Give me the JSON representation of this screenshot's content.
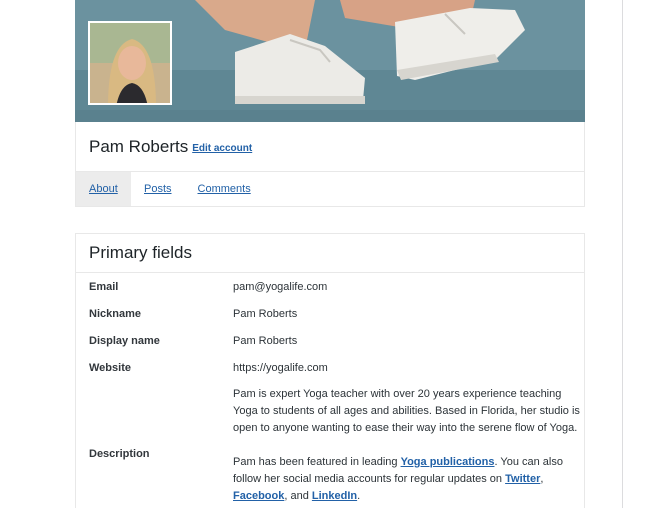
{
  "profile": {
    "name": "Pam Roberts",
    "edit_label": "Edit account"
  },
  "tabs": [
    {
      "label": "About",
      "active": true
    },
    {
      "label": "Posts",
      "active": false
    },
    {
      "label": "Comments",
      "active": false
    }
  ],
  "fields": {
    "title": "Primary fields",
    "email_label": "Email",
    "email_value": "pam@yogalife.com",
    "nickname_label": "Nickname",
    "nickname_value": "Pam Roberts",
    "display_label": "Display name",
    "display_value": "Pam Roberts",
    "website_label": "Website",
    "website_value": "https://yogalife.com",
    "description_label": "Description",
    "description_p1": "Pam is expert Yoga teacher with over 20 years experience teaching Yoga to students of all ages and abilities. Based in Florida, her studio is open to anyone wanting to ease their way into the serene flow of Yoga.",
    "description_p2": {
      "before": "Pam has been featured in leading ",
      "link1": "Yoga publications",
      "middle": ". You can also follow her social media accounts for regular updates on ",
      "link2": "Twitter",
      "sep1": ", ",
      "link3": "Facebook",
      "sep2": ", and ",
      "link4": "LinkedIn",
      "end": "."
    }
  },
  "colors": {
    "link": "#2261a7",
    "tab_active_bg": "#ececec",
    "banner_bg": "#6f95a2"
  }
}
